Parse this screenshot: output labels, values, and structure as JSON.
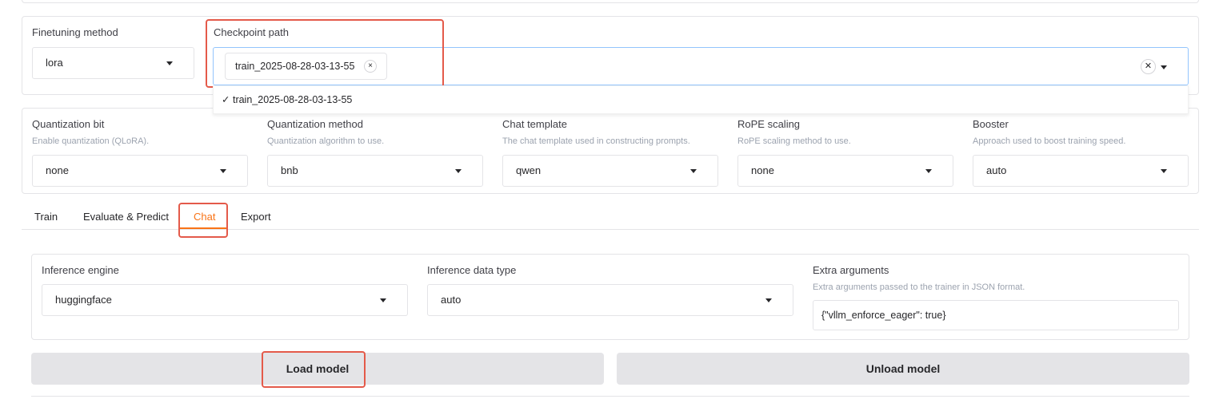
{
  "finetune": {
    "method_label": "Finetuning method",
    "method_value": "lora",
    "checkpoint_label": "Checkpoint path",
    "checkpoint_token": "train_2025-08-28-03-13-55",
    "token_remove": "×",
    "clear_glyph": "✕",
    "option_check": "✓",
    "option_label": "train_2025-08-28-03-13-55"
  },
  "advanced": [
    {
      "label": "Quantization bit",
      "info": "Enable quantization (QLoRA).",
      "value": "none"
    },
    {
      "label": "Quantization method",
      "info": "Quantization algorithm to use.",
      "value": "bnb"
    },
    {
      "label": "Chat template",
      "info": "The chat template used in constructing prompts.",
      "value": "qwen"
    },
    {
      "label": "RoPE scaling",
      "info": "RoPE scaling method to use.",
      "value": "none"
    },
    {
      "label": "Booster",
      "info": "Approach used to boost training speed.",
      "value": "auto"
    }
  ],
  "tabs": [
    "Train",
    "Evaluate & Predict",
    "Chat",
    "Export"
  ],
  "active_tab": "Chat",
  "accent_color": "#f97316",
  "chat": {
    "engine_label": "Inference engine",
    "engine_value": "huggingface",
    "dtype_label": "Inference data type",
    "dtype_value": "auto",
    "extra_label": "Extra arguments",
    "extra_info": "Extra arguments passed to the trainer in JSON format.",
    "extra_value": "{\"vllm_enforce_eager\": true}",
    "load_button": "Load model",
    "unload_button": "Unload model"
  }
}
